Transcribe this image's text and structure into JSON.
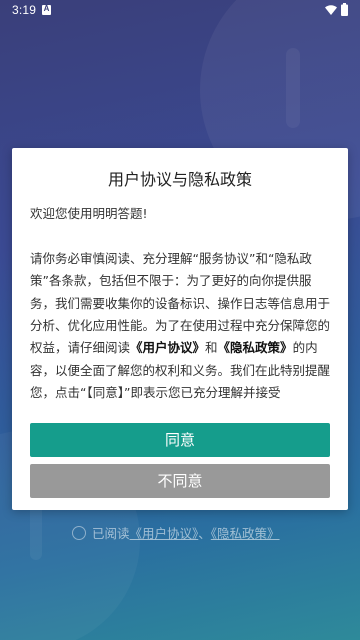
{
  "status_bar": {
    "time": "3:19",
    "notification_letter": "A",
    "icons": [
      "a-notification-icon",
      "wifi-icon",
      "battery-icon"
    ]
  },
  "dialog": {
    "title": "用户协议与隐私政策",
    "greeting": "欢迎您使用明明答题!",
    "body": {
      "part1": "请你务必审慎阅读、充分理解“服务协议”和“隐私政策”各条款，包括但不限于：为了更好的向你提供服务，我们需要收集你的设备标识、操作日志等信息用于分析、优化应用性能。为了在使用过程中充分保障您的权益，请仔细阅读",
      "link1": "《用户协议》",
      "and": "和",
      "link2": "《隐私政策》",
      "part2": "的内容，以便全面了解您的权利和义务。我们在此特别提醒您，点击“【同意】”即表示您已充分理解并接受"
    },
    "agree_label": "同意",
    "disagree_label": "不同意"
  },
  "agreement": {
    "prefix": "已阅读",
    "user_agreement": "《用户协议》",
    "separator": "、",
    "privacy_policy": "《隐私政策》"
  },
  "colors": {
    "agree_button": "#159d8c",
    "disagree_button": "#999999",
    "background_top": "#3a3f7a",
    "background_bottom": "#2e8a9a"
  }
}
